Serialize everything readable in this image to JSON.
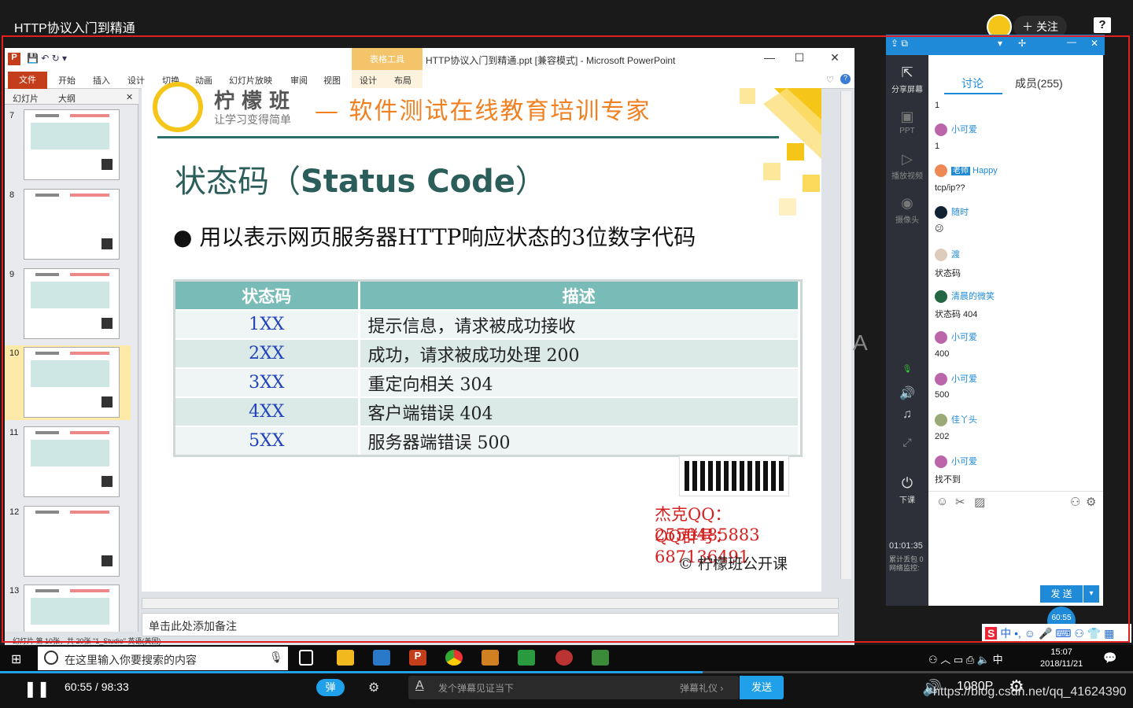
{
  "video": {
    "title": "HTTP协议入门到精通",
    "follow_label": "关注",
    "help_label": "?",
    "current_time": "60:55",
    "total_time": "98:33",
    "time_display": "60:55 / 98:33",
    "progress": 0.62,
    "danmu_toggle": "弹",
    "danmu_placeholder": "发个弹幕见证当下",
    "danmu_gift": "弹幕礼仪 ›",
    "danmu_send": "发送",
    "quality": "1080P",
    "watermark": "https://blog.csdn.net/qq_41624390"
  },
  "ppt": {
    "window_title": "HTTP协议入门到精通.ppt [兼容模式] - Microsoft PowerPoint",
    "context_tab": "表格工具",
    "file_tab": "文件",
    "tabs": [
      "开始",
      "插入",
      "设计",
      "切换",
      "动画",
      "幻灯片放映",
      "审阅",
      "视图"
    ],
    "context_tabs": [
      "设计",
      "布局"
    ],
    "pane_tabs": [
      "幻灯片",
      "大纲"
    ],
    "thumbnails": [
      "7",
      "8",
      "9",
      "10",
      "11",
      "12",
      "13"
    ],
    "selected_thumbnail": "10",
    "notes_placeholder": "单击此处添加备注",
    "status": "幻灯片 第 10张，共 20张    \"1_Studio\"    英语(美国)"
  },
  "slide": {
    "logo_text": "柠 檬 班",
    "logo_sub": "让学习变得简单",
    "slogan": "— 软件测试在线教育培训专家",
    "title_cn": "状态码（",
    "title_en": "Status Code",
    "title_end": "）",
    "bullet": "用以表示网页服务器HTTP响应状态的3位数字代码",
    "table_headers": [
      "状态码",
      "描述"
    ],
    "table_rows": [
      {
        "code": "1XX",
        "desc": "提示信息，请求被成功接收"
      },
      {
        "code": "2XX",
        "desc": "成功，请求被成功处理  200"
      },
      {
        "code": "3XX",
        "desc": "重定向相关  304"
      },
      {
        "code": "4XX",
        "desc": "客户端错误 404"
      },
      {
        "code": "5XX",
        "desc": "服务器端错误  500"
      }
    ],
    "qq_contact": "杰克QQ：2550485883",
    "qq_group": "QQ群号：687136491",
    "copyright": "© 柠檬班公开课"
  },
  "live": {
    "sidebar": [
      "分享屏幕",
      "PPT",
      "播放视频",
      "摄像头",
      "下课"
    ],
    "tabs": {
      "discussion": "讨论",
      "members": "成员(255)"
    },
    "messages": [
      {
        "user": "",
        "text": "1"
      },
      {
        "user": "小可爱",
        "text": "1"
      },
      {
        "user": "Happy",
        "tag": "老师",
        "text": "tcp/ip??"
      },
      {
        "user": "随时",
        "text": "😕"
      },
      {
        "user": "渡",
        "text": "状态码"
      },
      {
        "user": "清晨的微笑",
        "text": "状态码 404"
      },
      {
        "user": "小可爱",
        "text": "400"
      },
      {
        "user": "小可爱",
        "text": "500"
      },
      {
        "user": "佳丫头",
        "text": "202"
      },
      {
        "user": "小可爱",
        "text": "找不到"
      }
    ],
    "send_label": "发 送",
    "elapsed": "01:01:35",
    "stats": "累计丢包 0 网络监控:",
    "timer": "60:55"
  },
  "taskbar": {
    "search_placeholder": "在这里输入你要搜索的内容",
    "time": "15:07",
    "date": "2018/11/21",
    "ime": "中"
  }
}
